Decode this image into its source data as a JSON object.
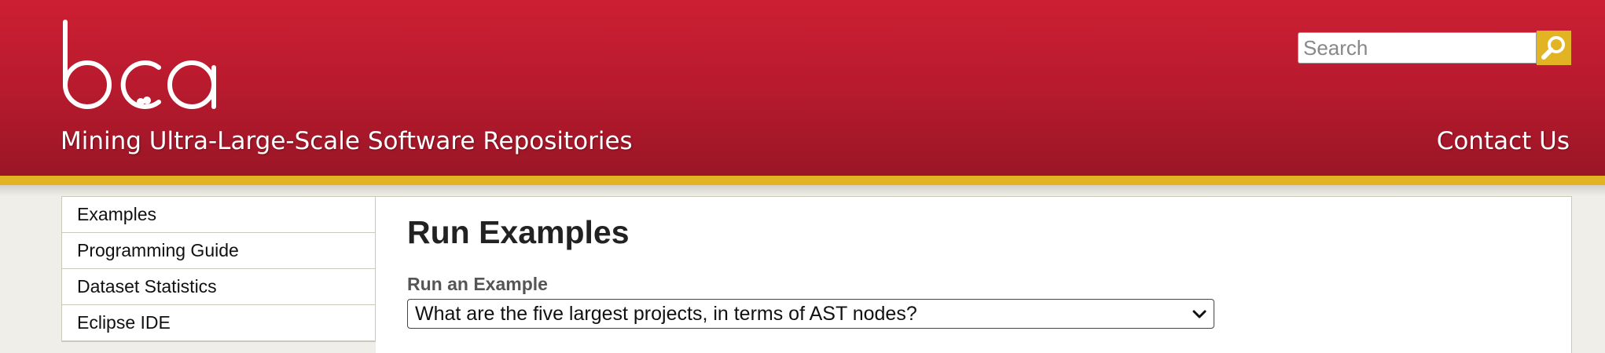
{
  "header": {
    "logo_text": "boa",
    "tagline": "Mining Ultra-Large-Scale Software Repositories",
    "contact_label": "Contact Us",
    "search": {
      "placeholder": "Search",
      "value": ""
    }
  },
  "sidebar": {
    "items": [
      {
        "label": "Examples"
      },
      {
        "label": "Programming Guide"
      },
      {
        "label": "Dataset Statistics"
      },
      {
        "label": "Eclipse IDE"
      }
    ]
  },
  "main": {
    "title": "Run Examples",
    "example_label": "Run an Example",
    "example_selected": "What are the five largest projects, in terms of AST nodes?"
  },
  "icons": {
    "search_button": "magnifier-icon",
    "select_chevron": "chevron-down-icon"
  },
  "colors": {
    "header_red": "#c21d31",
    "accent_gold": "#e2b323",
    "page_background": "#efeee8"
  }
}
